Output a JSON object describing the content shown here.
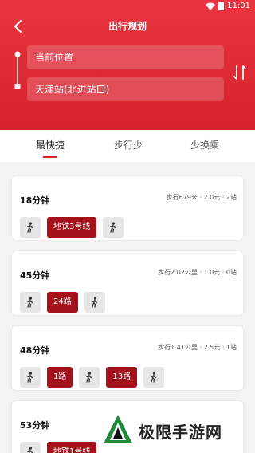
{
  "status_bar": {
    "time": "11:01"
  },
  "header": {
    "title": "出行规划",
    "from_value": "当前位置",
    "to_value": "天津站(北进站口)"
  },
  "tabs": [
    {
      "label": "最快捷",
      "active": true
    },
    {
      "label": "步行少",
      "active": false
    },
    {
      "label": "少换乘",
      "active": false
    }
  ],
  "routes": [
    {
      "duration": "18分钟",
      "meta": "步行679米 · 2.0元 · 2站",
      "segments": [
        {
          "type": "walk"
        },
        {
          "type": "line",
          "label": "地铁3号线"
        },
        {
          "type": "walk"
        }
      ]
    },
    {
      "duration": "45分钟",
      "meta": "步行2.02公里 · 1.0元 · 0站",
      "segments": [
        {
          "type": "walk"
        },
        {
          "type": "line",
          "label": "24路"
        },
        {
          "type": "walk"
        }
      ]
    },
    {
      "duration": "48分钟",
      "meta": "步行1.41公里 · 2.5元 · 1站",
      "segments": [
        {
          "type": "walk"
        },
        {
          "type": "line",
          "label": "1路"
        },
        {
          "type": "walk"
        },
        {
          "type": "line",
          "label": "13路"
        },
        {
          "type": "walk"
        }
      ]
    },
    {
      "duration": "53分钟",
      "meta": "",
      "segments": [
        {
          "type": "walk"
        },
        {
          "type": "line",
          "label": "地铁1号线"
        }
      ]
    }
  ],
  "watermark": {
    "text": "极限手游网"
  },
  "colors": {
    "brand_red": "#d7222c",
    "line_badge": "#a3111a"
  }
}
